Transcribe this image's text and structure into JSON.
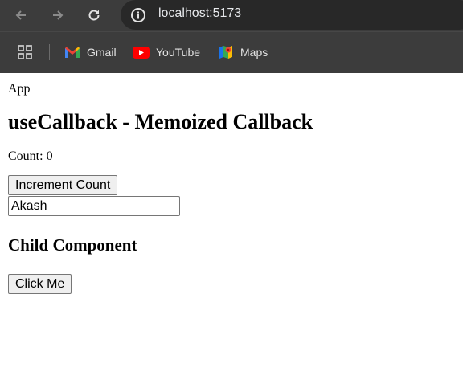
{
  "browser": {
    "url": "localhost:5173",
    "bookmarks": [
      {
        "label": "Gmail",
        "icon": "gmail-icon"
      },
      {
        "label": "YouTube",
        "icon": "youtube-icon"
      },
      {
        "label": "Maps",
        "icon": "maps-icon"
      }
    ]
  },
  "page": {
    "app_label": "App",
    "title": "useCallback - Memoized Callback",
    "count_text": "Count: 0",
    "increment_button_label": "Increment Count",
    "name_input_value": "Akash",
    "child_title": "Child Component",
    "click_button_label": "Click Me"
  },
  "colors": {
    "chrome_bg": "#3c3c3c",
    "omnibox_bg": "#282828",
    "chrome_text": "#e3e3e3"
  }
}
